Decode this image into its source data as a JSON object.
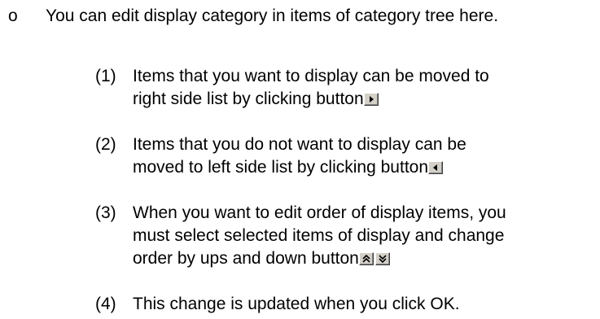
{
  "bullet": "o",
  "intro": "You can edit display category in items of category tree here.",
  "items": [
    {
      "num": "(1)",
      "text_a": "Items that you want to display can be moved to",
      "text_b": "right side list by clicking button"
    },
    {
      "num": "(2)",
      "text_a": "Items that you do not want to display can be",
      "text_b": "moved to left side list by clicking button"
    },
    {
      "num": "(3)",
      "text_a": "When you want to edit order of display items, you",
      "text_b": "must select selected items of display and change",
      "text_c": "order by ups and down button"
    },
    {
      "num": "(4)",
      "text_a": "This change is updated when you click OK."
    }
  ],
  "icons": {
    "move_right": "arrow-right-icon",
    "move_left": "arrow-left-icon",
    "move_up": "double-chevron-up-icon",
    "move_down": "double-chevron-down-icon"
  }
}
